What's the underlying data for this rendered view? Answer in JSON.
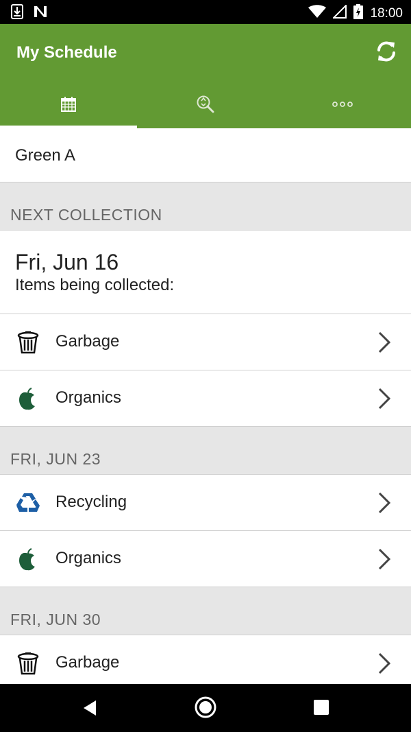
{
  "status": {
    "time": "18:00"
  },
  "app": {
    "title": "My Schedule"
  },
  "tabs": [
    {
      "icon": "calendar-icon",
      "active": true
    },
    {
      "icon": "search-recycle-icon",
      "active": false
    },
    {
      "icon": "more-icon",
      "active": false
    }
  ],
  "group": "Green A",
  "next_header": "NEXT COLLECTION",
  "next": {
    "date": "Fri, Jun 16",
    "subtitle": "Items being collected:"
  },
  "next_items": [
    {
      "label": "Garbage",
      "icon": "garbage-bin-icon"
    },
    {
      "label": "Organics",
      "icon": "apple-icon"
    }
  ],
  "sections": [
    {
      "header": "FRI, JUN 23",
      "items": [
        {
          "label": "Recycling",
          "icon": "recycle-icon"
        },
        {
          "label": "Organics",
          "icon": "apple-icon"
        }
      ]
    },
    {
      "header": "FRI, JUN 30",
      "items": [
        {
          "label": "Garbage",
          "icon": "garbage-bin-icon"
        }
      ]
    }
  ],
  "colors": {
    "app_bar": "#629a33",
    "organics": "#1e5e3a",
    "recycling": "#1d5fa6"
  }
}
